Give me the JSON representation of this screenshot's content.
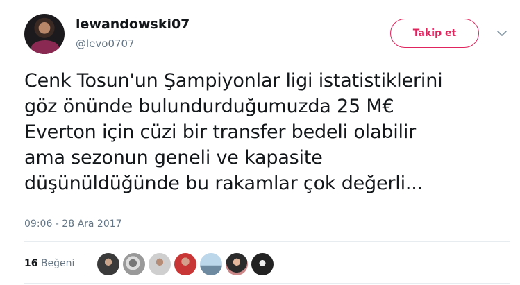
{
  "user": {
    "name": "lewandowski07",
    "handle": "@levo0707",
    "avatar_icon": "user-avatar"
  },
  "follow_button": {
    "label": "Takip et",
    "color": "#e0245e"
  },
  "menu": {
    "caret_icon": "chevron-down-icon"
  },
  "tweet": {
    "lines": [
      "Cenk Tosun'un Şampiyonlar ligi istatistiklerini",
      "göz önünde bulundurduğumuzda 25 M€",
      "Everton için cüzi bir transfer bedeli olabilir",
      "ama sezonun geneli ve kapasite",
      "düşünüldüğünde bu rakamlar çok değerli..."
    ],
    "timestamp": "09:06 - 28 Ara 2017"
  },
  "likes": {
    "count": "16",
    "label": "Beğeni",
    "liker_avatars": [
      "liker-avatar",
      "liker-avatar",
      "liker-avatar",
      "liker-avatar",
      "liker-avatar",
      "liker-avatar",
      "liker-avatar"
    ]
  }
}
